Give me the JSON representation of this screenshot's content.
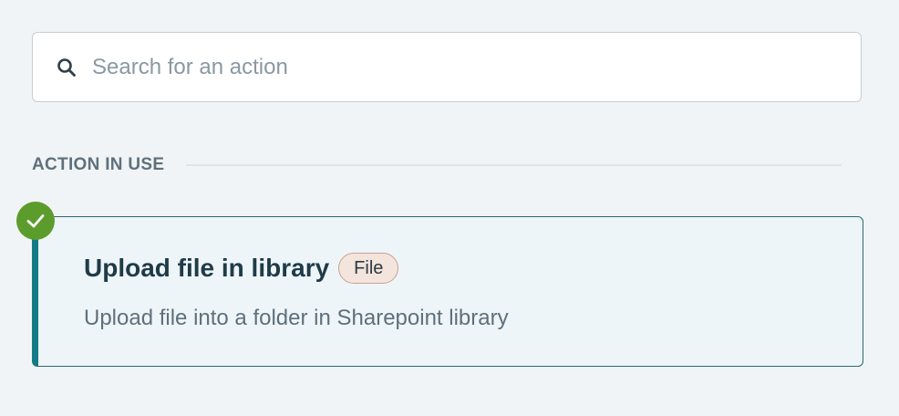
{
  "search": {
    "placeholder": "Search for an action",
    "value": "",
    "icon": "search-icon"
  },
  "section": {
    "title": "ACTION IN USE"
  },
  "action": {
    "title": "Upload file in library",
    "tag": "File",
    "description": "Upload file into a folder in Sharepoint library",
    "status_icon": "checkmark-icon",
    "colors": {
      "accent": "#137b86",
      "check": "#5c9c2c",
      "tag_bg": "#f3e4dc"
    }
  }
}
